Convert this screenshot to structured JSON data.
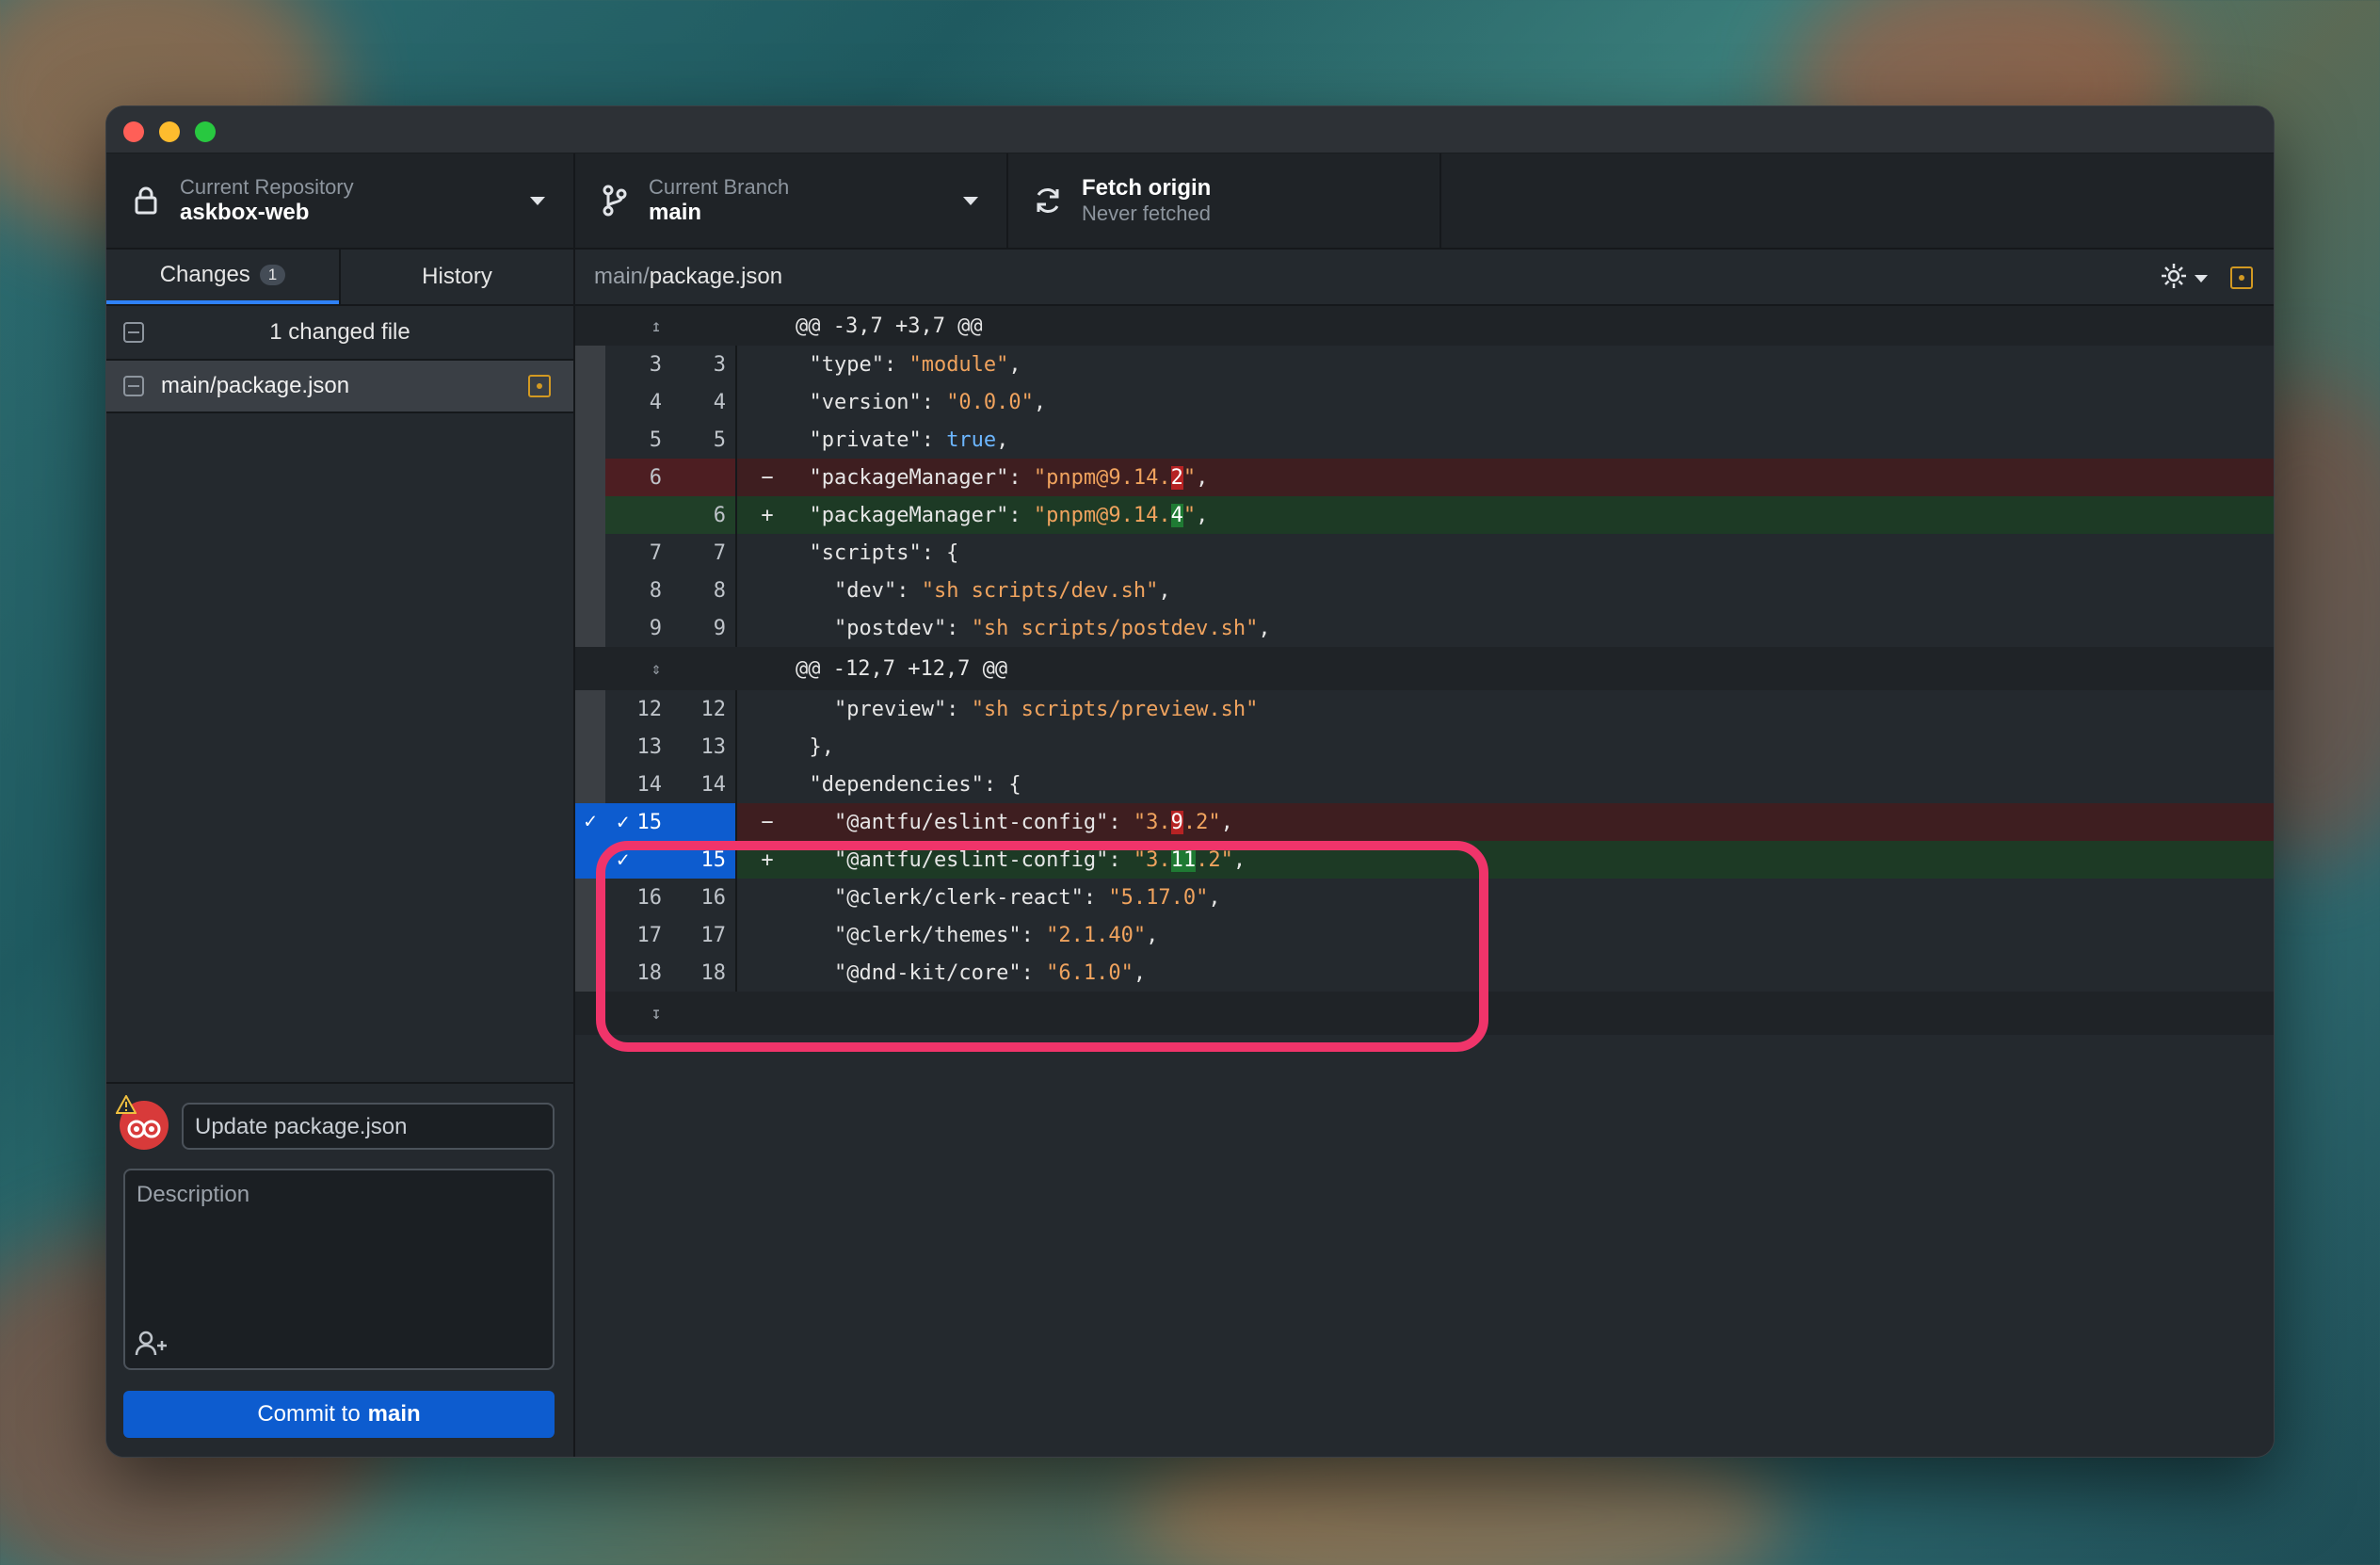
{
  "window": {
    "current_repository_label": "Current Repository",
    "current_repository_value": "askbox-web",
    "current_branch_label": "Current Branch",
    "current_branch_value": "main",
    "fetch_label": "Fetch origin",
    "fetch_sub": "Never fetched"
  },
  "sidebar": {
    "tabs": [
      {
        "label": "Changes",
        "badge": "1"
      },
      {
        "label": "History"
      }
    ],
    "changed_files_header": "1 changed file",
    "files": [
      {
        "name": "main/package.json"
      }
    ],
    "commit": {
      "summary_placeholder": "Update package.json",
      "description_placeholder": "Description",
      "button_prefix": "Commit to",
      "button_branch": "main"
    }
  },
  "diff": {
    "path_dir": "main/",
    "path_file": "package.json",
    "hunk1": "@@ -3,7 +3,7 @@",
    "hunk2": "@@ -12,7 +12,7 @@",
    "lines": [
      {
        "o": "3",
        "n": "3",
        "t": "ctx"
      },
      {
        "o": "4",
        "n": "4",
        "t": "ctx"
      },
      {
        "o": "5",
        "n": "5",
        "t": "ctx"
      },
      {
        "o": "6",
        "n": "",
        "t": "del"
      },
      {
        "o": "",
        "n": "6",
        "t": "add"
      },
      {
        "o": "7",
        "n": "7",
        "t": "ctx"
      },
      {
        "o": "8",
        "n": "8",
        "t": "ctx"
      },
      {
        "o": "9",
        "n": "9",
        "t": "ctx"
      },
      {
        "o": "12",
        "n": "12",
        "t": "ctx"
      },
      {
        "o": "13",
        "n": "13",
        "t": "ctx"
      },
      {
        "o": "14",
        "n": "14",
        "t": "ctx"
      },
      {
        "o": "15",
        "n": "",
        "t": "del"
      },
      {
        "o": "",
        "n": "15",
        "t": "add"
      },
      {
        "o": "16",
        "n": "16",
        "t": "ctx"
      },
      {
        "o": "17",
        "n": "17",
        "t": "ctx"
      },
      {
        "o": "18",
        "n": "18",
        "t": "ctx"
      }
    ]
  },
  "colors": {
    "accent": "#0d5ccf",
    "annotation": "#f0346a",
    "deleted": "#b62324",
    "added": "#1f7a33"
  }
}
